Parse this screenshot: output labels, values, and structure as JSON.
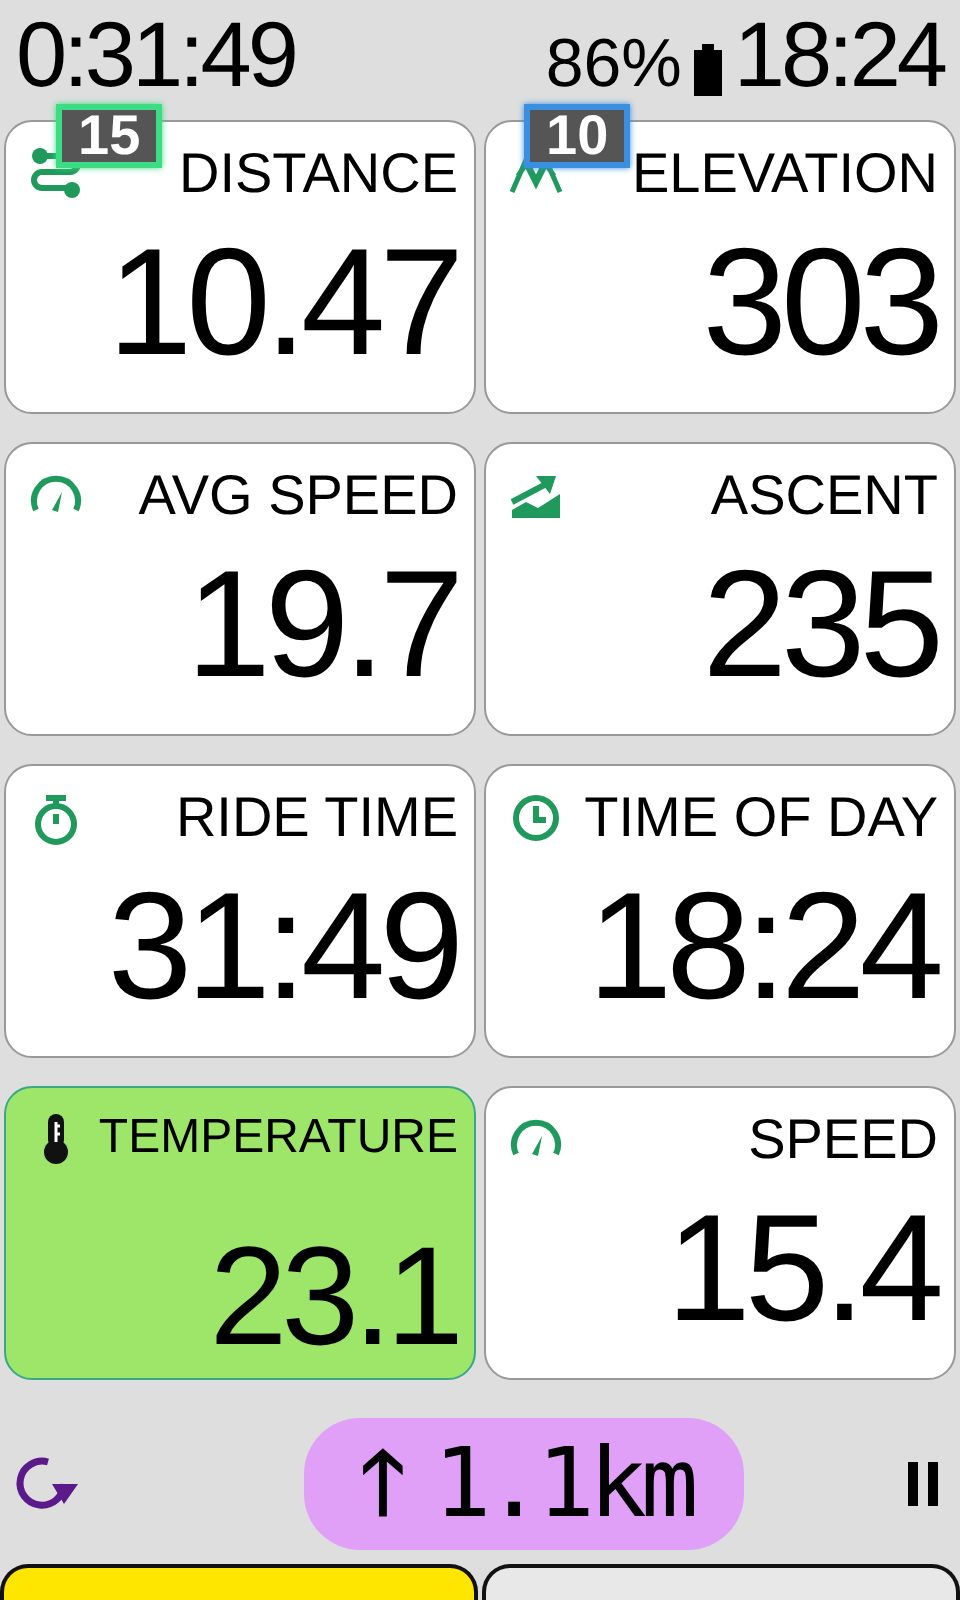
{
  "status_bar": {
    "ride_timer": "0:31:49",
    "battery_percent": "86%",
    "clock": "18:24"
  },
  "overlay_badges": [
    {
      "label": "15",
      "color": "#3ddc84"
    },
    {
      "label": "10",
      "color": "#3b8fe0"
    }
  ],
  "fields": [
    {
      "label": "DISTANCE",
      "value": "10.47",
      "kind": "route",
      "highlighted": false
    },
    {
      "label": "ELEVATION",
      "value": "303",
      "kind": "mountains",
      "highlighted": false
    },
    {
      "label": "AVG SPEED",
      "value": "19.7",
      "kind": "gauge",
      "highlighted": false
    },
    {
      "label": "ASCENT",
      "value": "235",
      "kind": "ascent",
      "highlighted": false
    },
    {
      "label": "RIDE TIME",
      "value": "31:49",
      "kind": "stopwatch",
      "highlighted": false
    },
    {
      "label": "TIME OF DAY",
      "value": "18:24",
      "kind": "clock",
      "highlighted": false
    },
    {
      "label": "TEMPERATURE",
      "value": "23.1",
      "kind": "thermometer",
      "highlighted": true
    },
    {
      "label": "SPEED",
      "value": "15.4",
      "kind": "gauge",
      "highlighted": false
    }
  ],
  "navigation": {
    "arrow": "🡑",
    "distance": "1.1km"
  },
  "page_tabs": [
    {
      "selected": true
    },
    {
      "selected": false
    }
  ]
}
